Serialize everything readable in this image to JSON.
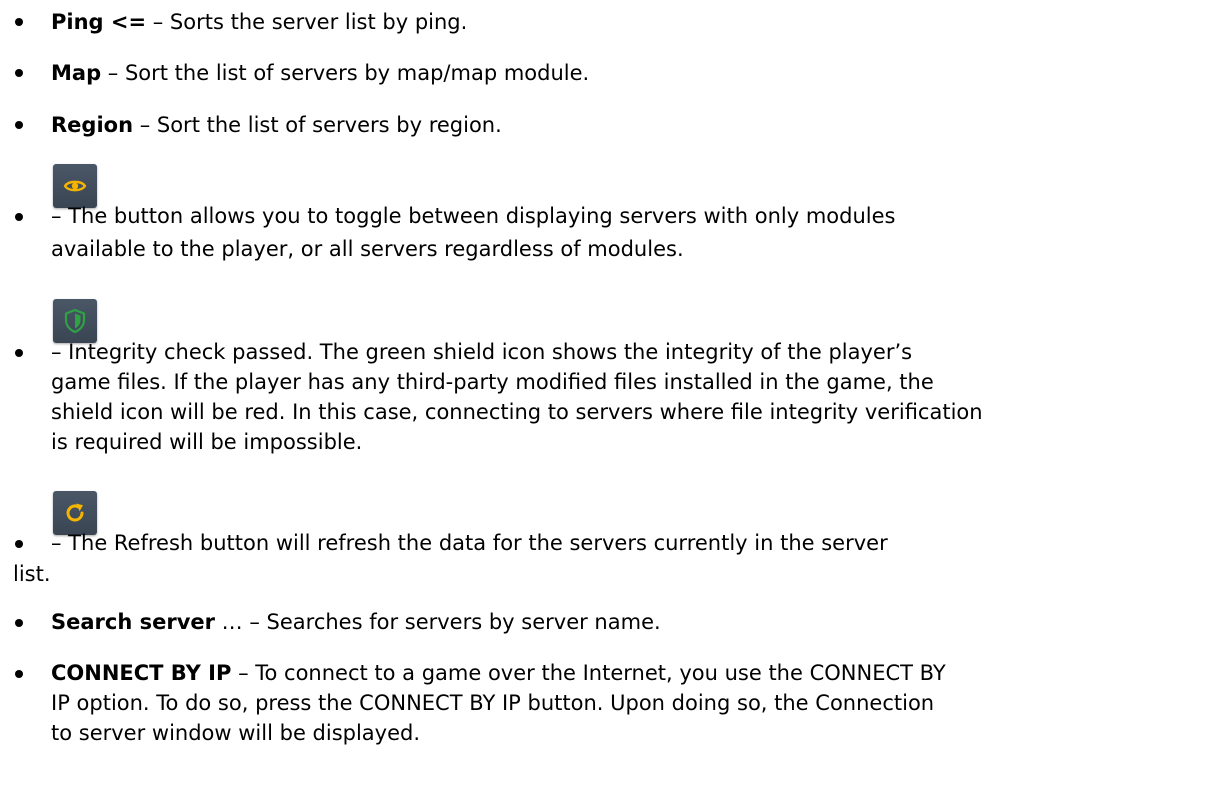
{
  "items": [
    {
      "term": "Ping <=",
      "desc": " – Sorts the server list by ping."
    },
    {
      "term": "Map",
      "desc": " – Sort the list of servers by map/map module."
    },
    {
      "term": "Region",
      "desc": " – Sort the list of servers by region."
    },
    {
      "icon": "eye-icon",
      "line1": " – The button allows you to toggle between displaying servers with only modules",
      "line2": "available to the player, or all servers regardless of modules."
    },
    {
      "icon": "shield-icon",
      "line1": " – Integrity check passed. The green shield icon shows the integrity of the player’s",
      "line2": "game files. If the player has any third-party modified files installed in the game, the",
      "line3": "shield icon will be red. In this case, connecting to servers where file integrity verification",
      "line4": "is required will be impossible."
    },
    {
      "icon": "refresh-icon",
      "line1": " – The Refresh button will refresh the data for the servers currently in the server",
      "line2": "list."
    },
    {
      "term": "Search server",
      "desc": " … – Searches for servers by server name."
    },
    {
      "term": "CONNECT BY IP",
      "line1": " – To connect to a game over the Internet, you use the CONNECT BY",
      "line2": "IP option.  To do so, press the CONNECT BY IP button.  Upon doing so, the Connection",
      "line3": "to server window will be displayed."
    }
  ],
  "colors": {
    "button_bg": "#404b59",
    "eye_accent": "#f5b400",
    "shield_accent": "#2fa344",
    "refresh_accent": "#f5b400"
  }
}
